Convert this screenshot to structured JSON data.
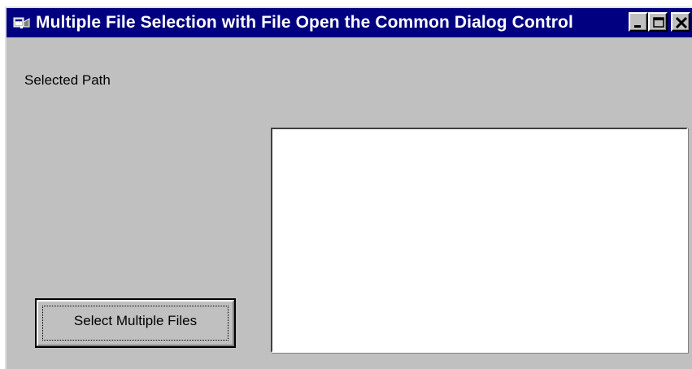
{
  "window": {
    "title": "Multiple File Selection with File Open the Common Dialog Control",
    "controls": {
      "minimize_icon": "minimize-icon",
      "maximize_icon": "maximize-icon",
      "close_icon": "close-icon"
    },
    "app_icon": "app-icon"
  },
  "form": {
    "path_label": "Selected Path",
    "path_textbox_value": "",
    "select_button_label": "Select Multiple Files"
  },
  "colors": {
    "titlebar": "#000080",
    "face": "#c0c0c0",
    "textbox": "#ffffff"
  }
}
